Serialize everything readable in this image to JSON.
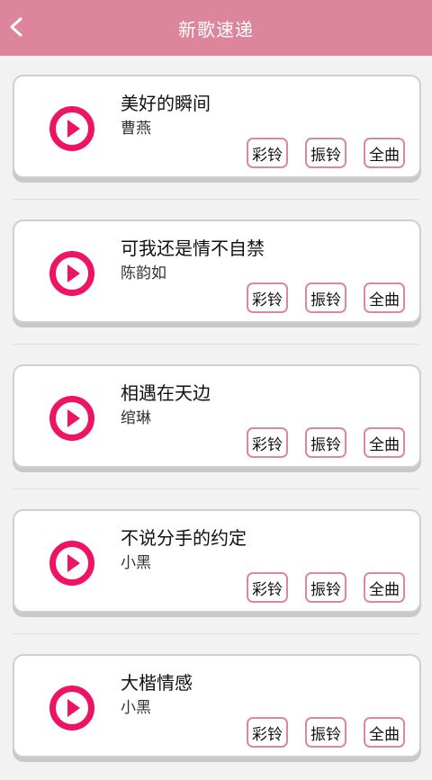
{
  "header": {
    "title": "新歌速递",
    "back_icon": "chevron-left-icon"
  },
  "colors": {
    "header_bg": "#dc859c",
    "play_icon": "#ee1465",
    "button_border": "#d9889f"
  },
  "songs": [
    {
      "title": "美好的瞬间",
      "artist": "曹燕",
      "buttons": [
        "彩铃",
        "振铃",
        "全曲"
      ]
    },
    {
      "title": "可我还是情不自禁",
      "artist": "陈韵如",
      "buttons": [
        "彩铃",
        "振铃",
        "全曲"
      ]
    },
    {
      "title": "相遇在天边",
      "artist": "绾琳",
      "buttons": [
        "彩铃",
        "振铃",
        "全曲"
      ]
    },
    {
      "title": "不说分手的约定",
      "artist": "小黑",
      "buttons": [
        "彩铃",
        "振铃",
        "全曲"
      ]
    },
    {
      "title": "大楷情感",
      "artist": "小黑",
      "buttons": [
        "彩铃",
        "振铃",
        "全曲"
      ]
    }
  ]
}
